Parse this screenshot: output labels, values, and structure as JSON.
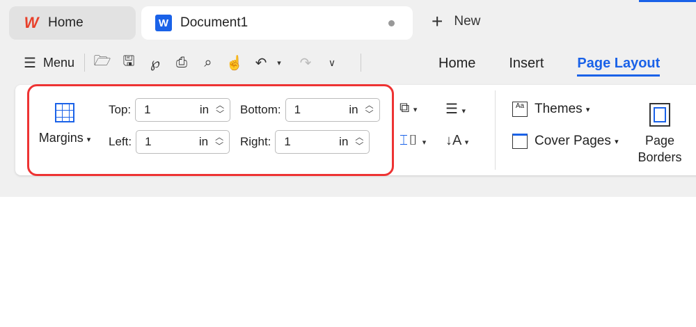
{
  "tabs": {
    "home": "Home",
    "document": "Document1",
    "new": "New"
  },
  "toolbar": {
    "menu": "Menu"
  },
  "menu_tabs": [
    "Home",
    "Insert",
    "Page Layout"
  ],
  "margins": {
    "label": "Margins",
    "top_label": "Top:",
    "top": "1",
    "bottom_label": "Bottom:",
    "bottom": "1",
    "left_label": "Left:",
    "left": "1",
    "right_label": "Right:",
    "right": "1",
    "unit": "in"
  },
  "ribbon": {
    "themes": "Themes",
    "cover_pages": "Cover Pages",
    "page_borders_1": "Page",
    "page_borders_2": "Borders"
  },
  "colors": {
    "accent": "#1a62e8",
    "highlight": "#e33333"
  }
}
